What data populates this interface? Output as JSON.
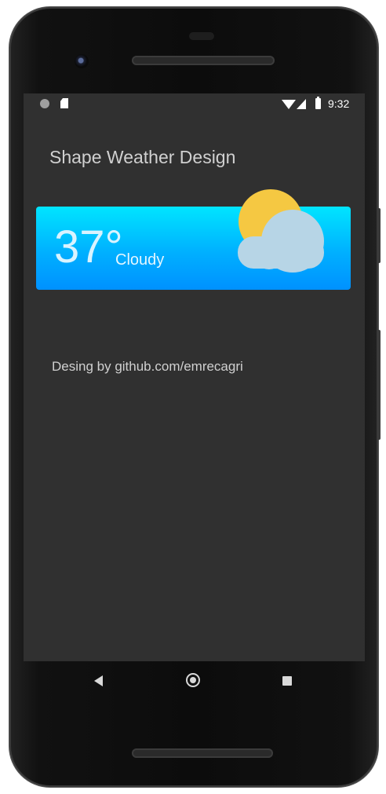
{
  "status_bar": {
    "time": "9:32"
  },
  "app": {
    "title": "Shape Weather Design"
  },
  "weather": {
    "temperature": "37°",
    "condition": "Cloudy",
    "icon": "sun-behind-cloud-icon"
  },
  "footer": {
    "credit": "Desing by github.com/emrecagri"
  },
  "nav": {
    "back_icon": "back-triangle-icon",
    "home_icon": "home-circle-icon",
    "recents_icon": "recents-square-icon"
  },
  "colors": {
    "screen_bg": "#303030",
    "card_gradient_top": "#00e5ff",
    "card_gradient_bottom": "#0091ff",
    "sun": "#f5c842",
    "cloud": "#b7d5e6"
  }
}
